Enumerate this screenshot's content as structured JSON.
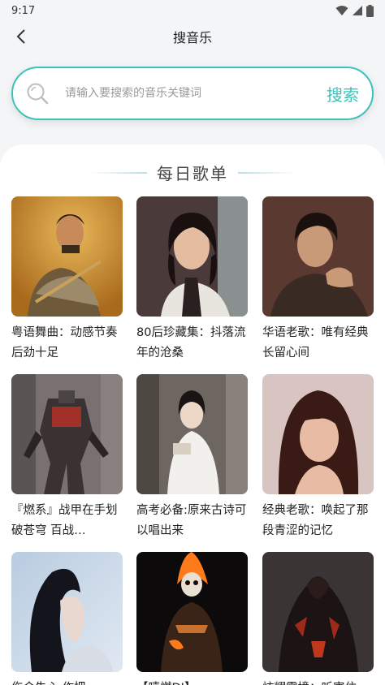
{
  "status": {
    "time": "9:17"
  },
  "header": {
    "title": "搜音乐"
  },
  "search": {
    "placeholder": "请输入要搜索的音乐关键词",
    "button_label": "搜索"
  },
  "section": {
    "title": "每日歌单"
  },
  "playlists": [
    {
      "title": "粤语舞曲：动感节奏后劲十足",
      "cover": "singer-with-flute"
    },
    {
      "title": "80后珍藏集：抖落流年的沧桑",
      "cover": "woman-portrait-retro"
    },
    {
      "title": "华语老歌：唯有经典长留心间",
      "cover": "man-portrait-sweater"
    },
    {
      "title": "『燃系』战甲在手划破苍穹 百战…",
      "cover": "robot-warrior"
    },
    {
      "title": "高考必备:原来古诗可以唱出来",
      "cover": "woman-hanfu"
    },
    {
      "title": "经典老歌：唤起了那段青涩的记忆",
      "cover": "woman-curly-hair"
    },
    {
      "title": "伤会失心 作把",
      "cover": "woman-profile-blue"
    },
    {
      "title": "【嘻燃DJ】",
      "cover": "ghost-rider-fire"
    },
    {
      "title": "炫耀霸境：听害住",
      "cover": "dark-armored-figure"
    }
  ]
}
